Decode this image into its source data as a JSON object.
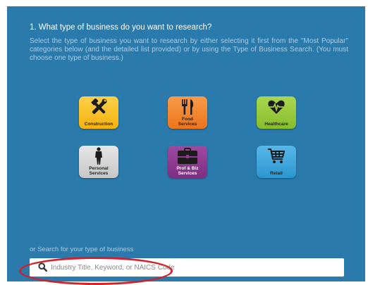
{
  "question": {
    "title": "1. What type of business do you want to research?",
    "description": "Select the type of business you want to research by either selecting it first from the \"Most Popular\" categories below (and the detailed list provided) or by using the Type of Business Search. (You must choose one type of business.)"
  },
  "categories": [
    {
      "label": "Construction",
      "icon": "tools-icon",
      "color": "#f9c41b"
    },
    {
      "label": "Food\nServices",
      "icon": "fork-knife-icon",
      "color": "#f58220"
    },
    {
      "label": "Healthcare",
      "icon": "heart-pulse-icon",
      "color": "#9bcc3b"
    },
    {
      "label": "Personal\nServices",
      "icon": "person-icon",
      "color": "#d6d6d6"
    },
    {
      "label": "Prof & Biz\nServices",
      "icon": "briefcase-icon",
      "color": "#8e3b8f"
    },
    {
      "label": "Retail",
      "icon": "shopping-cart-icon",
      "color": "#3aa7dd"
    }
  ],
  "search": {
    "label": "or Search for your type of business",
    "placeholder": "Industry Title, Keyword, or NAICS Code"
  },
  "colors": {
    "panel": "#2a7aac",
    "highlight": "#d1222c"
  }
}
